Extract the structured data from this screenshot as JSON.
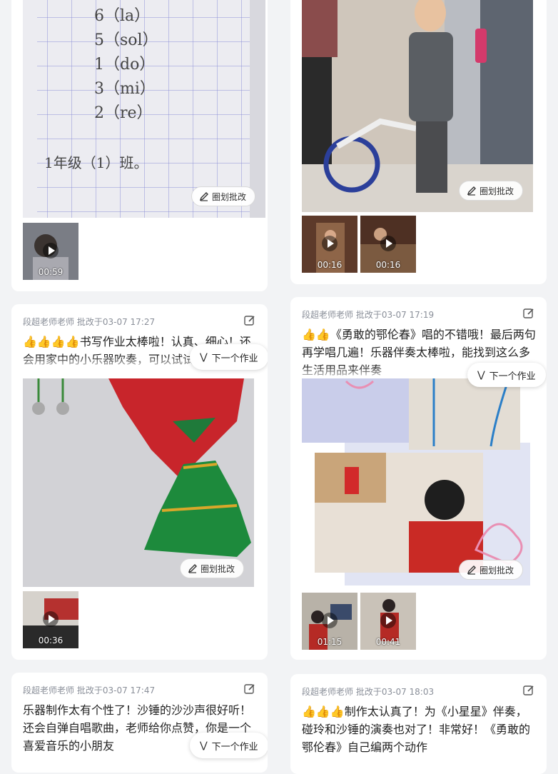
{
  "annotate_label": "圈划批改",
  "next_label": "下一个作业",
  "cards": {
    "c1": {
      "notebook": [
        "6（la）",
        "5（sol）",
        "1（do）",
        "3（mi）",
        "2（re）",
        "1年级（1）班。"
      ],
      "videos": [
        {
          "duration": "00:59"
        }
      ]
    },
    "c2": {
      "videos": [
        {
          "duration": "00:16"
        },
        {
          "duration": "00:16"
        }
      ]
    },
    "c3": {
      "teacher": "段超老师老师",
      "reviewed": "批改于03-07 17:27",
      "emoji": "👍👍👍👍",
      "comment": "书写作业太棒啦！认真、细心！还会用家中的小乐器吹奏，可以试试制作沙锤来伴奏哦！",
      "videos": [
        {
          "duration": "00:36"
        }
      ]
    },
    "c4": {
      "teacher": "段超老师老师",
      "reviewed": "批改于03-07 17:19",
      "emoji": "👍👍",
      "comment": "《勇敢的鄂伦春》唱的不错哦！最后两句再学唱几遍！乐器伴奏太棒啦，能找到这么多生活用品来伴奏",
      "videos": [
        {
          "duration": "01:15"
        },
        {
          "duration": "00:41"
        }
      ]
    },
    "c5": {
      "teacher": "段超老师老师",
      "reviewed": "批改于03-07 17:47",
      "emoji": "",
      "comment": "乐器制作太有个性了！沙锤的沙沙声很好听！还会自弹自唱歌曲，老师给你点赞，你是一个喜爱音乐的小朋友"
    },
    "c6": {
      "teacher": "段超老师老师",
      "reviewed": "批改于03-07 18:03",
      "emoji": "👍👍👍",
      "comment": "制作太认真了！为《小星星》伴奏，碰玲和沙锤的演奏也对了！非常好！《勇敢的鄂伦春》自己编两个动作"
    }
  }
}
